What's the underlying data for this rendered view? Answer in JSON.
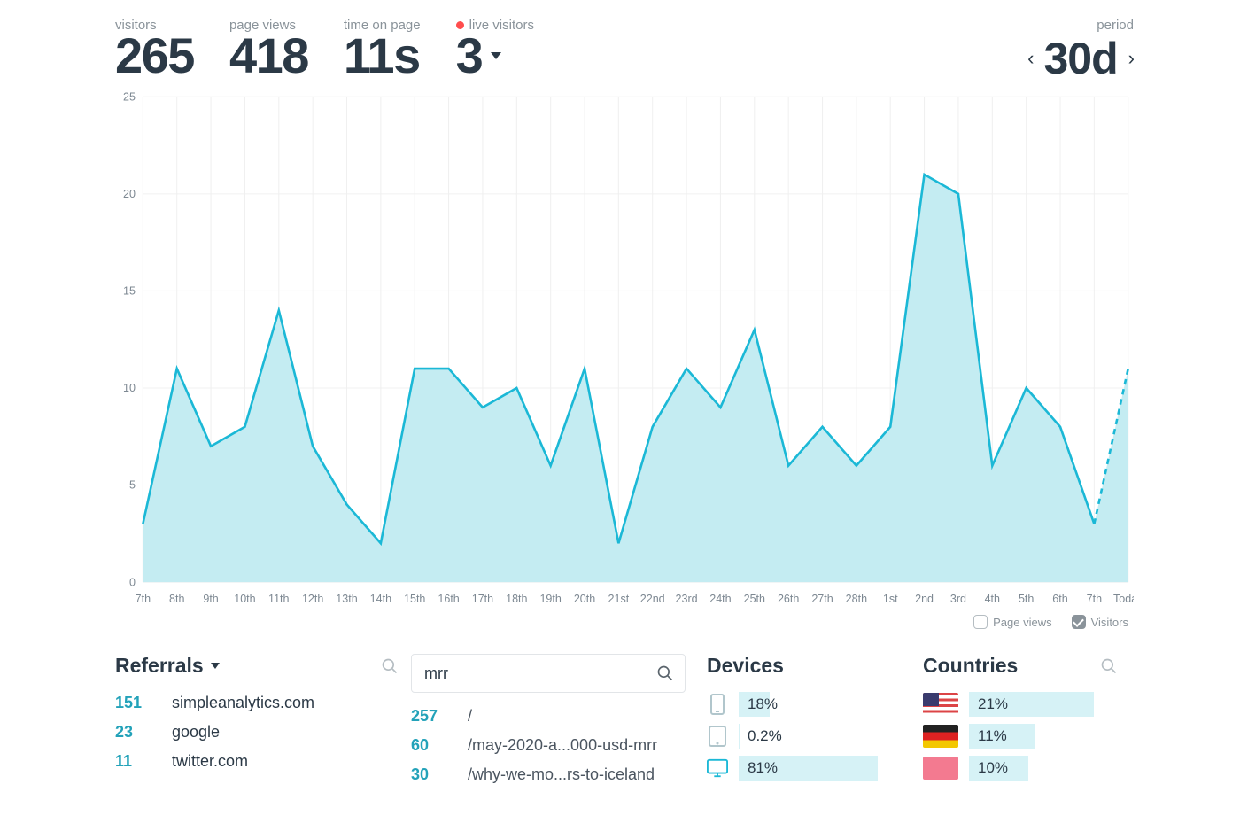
{
  "stats": {
    "visitors": {
      "label": "visitors",
      "value": "265"
    },
    "pageviews": {
      "label": "page views",
      "value": "418"
    },
    "time_on_page": {
      "label": "time on page",
      "value": "11s"
    },
    "live": {
      "label": "live visitors",
      "value": "3"
    }
  },
  "period": {
    "label": "period",
    "value": "30d"
  },
  "legend": {
    "pageviews": {
      "label": "Page views",
      "checked": false
    },
    "visitors": {
      "label": "Visitors",
      "checked": true
    }
  },
  "referrals": {
    "title": "Referrals",
    "items": [
      {
        "count": "151",
        "name": "simpleanalytics.com"
      },
      {
        "count": "23",
        "name": "google"
      },
      {
        "count": "11",
        "name": "twitter.com"
      }
    ]
  },
  "pages_panel": {
    "search_value": "mrr",
    "items": [
      {
        "count": "257",
        "path": "/"
      },
      {
        "count": "60",
        "path": "/may-2020-a...000-usd-mrr"
      },
      {
        "count": "30",
        "path": "/why-we-mo...rs-to-iceland"
      }
    ]
  },
  "devices": {
    "title": "Devices",
    "items": [
      {
        "icon": "phone",
        "pct": 18,
        "label": "18%"
      },
      {
        "icon": "tablet",
        "pct": 0.2,
        "label": "0.2%"
      },
      {
        "icon": "desktop",
        "pct": 81,
        "label": "81%",
        "highlight": true
      }
    ]
  },
  "countries": {
    "title": "Countries",
    "items": [
      {
        "flag": "us",
        "pct": 21,
        "label": "21%"
      },
      {
        "flag": "de",
        "pct": 11,
        "label": "11%"
      },
      {
        "flag": "pink",
        "pct": 10,
        "label": "10%"
      }
    ]
  },
  "chart_data": {
    "type": "area",
    "title": "",
    "ylabel": "",
    "ylim": [
      0,
      25
    ],
    "yticks": [
      0,
      5,
      10,
      15,
      20,
      25
    ],
    "categories": [
      "7th",
      "8th",
      "9th",
      "10th",
      "11th",
      "12th",
      "13th",
      "14th",
      "15th",
      "16th",
      "17th",
      "18th",
      "19th",
      "20th",
      "21st",
      "22nd",
      "23rd",
      "24th",
      "25th",
      "26th",
      "27th",
      "28th",
      "1st",
      "2nd",
      "3rd",
      "4th",
      "5th",
      "6th",
      "7th",
      "Today"
    ],
    "series": [
      {
        "name": "Visitors",
        "values": [
          3,
          11,
          7,
          8,
          14,
          7,
          4,
          2,
          11,
          11,
          9,
          10,
          6,
          11,
          2,
          8,
          11,
          9,
          13,
          6,
          8,
          6,
          8,
          21,
          20,
          6,
          10,
          8,
          3,
          11
        ],
        "last_point_projected": true
      }
    ]
  }
}
